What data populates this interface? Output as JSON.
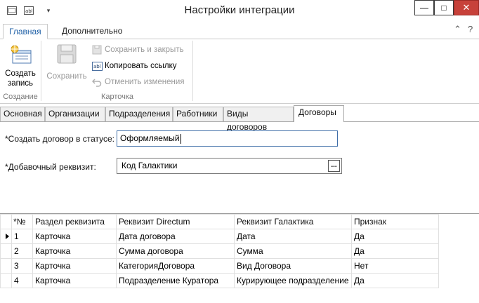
{
  "window": {
    "title": "Настройки интеграции",
    "qat_icons": [
      "form-icon",
      "dropdown-arrow-icon"
    ],
    "controls": {
      "minimize": "—",
      "maximize": "□",
      "close": "✕"
    }
  },
  "ribbon": {
    "tabs": [
      {
        "label": "Главная",
        "active": true
      },
      {
        "label": "Дополнительно",
        "active": false
      }
    ],
    "collapse_glyph": "⌃",
    "help_glyph": "?",
    "groups": {
      "create": {
        "label": "Создание",
        "new_record_label": [
          "Создать",
          "запись"
        ]
      },
      "card": {
        "label": "Карточка",
        "save_label": "Сохранить",
        "save_close_label": "Сохранить и закрыть",
        "copy_link_label": "Копировать ссылку",
        "cancel_changes_label": "Отменить изменения"
      }
    }
  },
  "form_tabs": [
    {
      "label": "Основная",
      "active": false
    },
    {
      "label": "Организации",
      "active": false
    },
    {
      "label": "Подразделения",
      "active": false
    },
    {
      "label": "Работники",
      "active": false
    },
    {
      "label": "Виды договоров",
      "active": false
    },
    {
      "label": "Договоры",
      "active": true
    }
  ],
  "fields": {
    "status": {
      "label": "*Создать договор в статусе:",
      "value": "Оформляемый"
    },
    "requisite": {
      "label": "*Добавочный реквизит:",
      "value": "Код Галактики",
      "button": "..."
    }
  },
  "grid": {
    "columns": [
      "*№",
      "Раздел реквизита",
      "Реквизит Directum",
      "Реквизит Галактика",
      "Признак"
    ],
    "rows": [
      {
        "n": "1",
        "section": "Карточка",
        "directum": "Дата договора",
        "galaktika": "Дата",
        "sign": "Да",
        "current": true
      },
      {
        "n": "2",
        "section": "Карточка",
        "directum": "Сумма договора",
        "galaktika": "Сумма",
        "sign": "Да",
        "current": false
      },
      {
        "n": "3",
        "section": "Карточка",
        "directum": "КатегорияДоговора",
        "galaktika": "Вид Договора",
        "sign": "Нет",
        "current": false
      },
      {
        "n": "4",
        "section": "Карточка",
        "directum": "Подразделение Куратора",
        "galaktika": "Курирующее подразделение",
        "sign": "Да",
        "current": false
      }
    ]
  },
  "colors": {
    "accent": "#1e5fa6",
    "close_button": "#c7413a",
    "disabled_text": "#9a9a9a"
  }
}
